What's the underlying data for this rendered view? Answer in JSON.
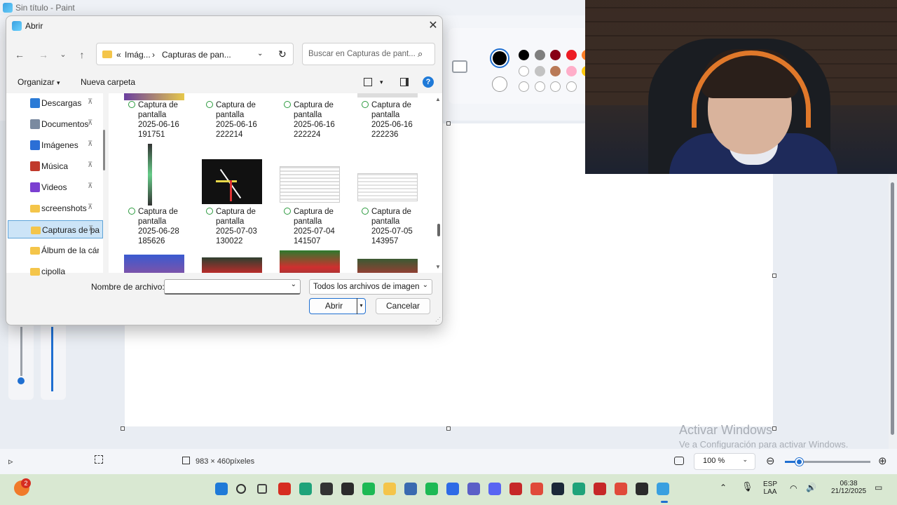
{
  "paint": {
    "title": "Sin título - Paint",
    "status_size": "983 × 460píxeles",
    "zoom": "100 %",
    "watermark_title": "Activar Windows",
    "watermark_sub": "Ve a Configuración para activar Windows."
  },
  "colors": {
    "selected_primary": "#000000",
    "selected_secondary": "#ffffff",
    "palette_row1": [
      "#000000",
      "#7f7f7f",
      "#880015",
      "#ed1c24",
      "#ff7f27"
    ],
    "palette_row2": [
      "#ffffff",
      "#c3c3c3",
      "#b97a57",
      "#ffaec9",
      "#ffc90e"
    ],
    "palette_row3": [
      "#ffffff",
      "#ffffff",
      "#ffffff",
      "#ffffff"
    ]
  },
  "dialog": {
    "title": "Abrir",
    "breadcrumb_1": "Imág...",
    "breadcrumb_2": "Capturas de pan...",
    "search_placeholder": "Buscar en Capturas de pant...",
    "organize": "Organizar",
    "new_folder": "Nueva carpeta",
    "nav_items": [
      {
        "label": "Descargas",
        "icon": "download-icon",
        "color": "#2b7bd6"
      },
      {
        "label": "Documentos",
        "icon": "document-icon",
        "color": "#7a8aa0"
      },
      {
        "label": "Imágenes",
        "icon": "image-icon",
        "color": "#2b6fd6"
      },
      {
        "label": "Música",
        "icon": "music-icon",
        "color": "#c0392b"
      },
      {
        "label": "Videos",
        "icon": "video-icon",
        "color": "#7b3fd1"
      },
      {
        "label": "screenshots",
        "icon": "folder-icon",
        "color": "#f4c54a"
      },
      {
        "label": "Capturas de pantalla",
        "icon": "folder-icon",
        "color": "#f4c54a"
      },
      {
        "label": "Álbum de la cámara",
        "icon": "folder-icon",
        "color": "#f4c54a"
      },
      {
        "label": "cipolla",
        "icon": "folder-icon",
        "color": "#f4c54a"
      }
    ],
    "files_row1": [
      {
        "line1": "Captura de",
        "line2": "pantalla",
        "line3": "2025-06-16",
        "line4": "191751"
      },
      {
        "line1": "Captura de",
        "line2": "pantalla",
        "line3": "2025-06-16",
        "line4": "222214"
      },
      {
        "line1": "Captura de",
        "line2": "pantalla",
        "line3": "2025-06-16",
        "line4": "222224"
      },
      {
        "line1": "Captura de",
        "line2": "pantalla",
        "line3": "2025-06-16",
        "line4": "222236"
      }
    ],
    "files_row2": [
      {
        "line1": "Captura de",
        "line2": "pantalla",
        "line3": "2025-06-28",
        "line4": "185626"
      },
      {
        "line1": "Captura de",
        "line2": "pantalla",
        "line3": "2025-07-03",
        "line4": "130022"
      },
      {
        "line1": "Captura de",
        "line2": "pantalla",
        "line3": "2025-07-04",
        "line4": "141507"
      },
      {
        "line1": "Captura de",
        "line2": "pantalla",
        "line3": "2025-07-05",
        "line4": "143957"
      }
    ],
    "filename_label": "Nombre de archivo:",
    "filename_value": "",
    "filetype": "Todos los archivos de imagen",
    "open_button": "Abrir",
    "cancel_button": "Cancelar"
  },
  "taskbar": {
    "notification_badge": "2",
    "lang_1": "ESP",
    "lang_2": "LAA",
    "time": "06:38",
    "date": "21/12/2025"
  }
}
